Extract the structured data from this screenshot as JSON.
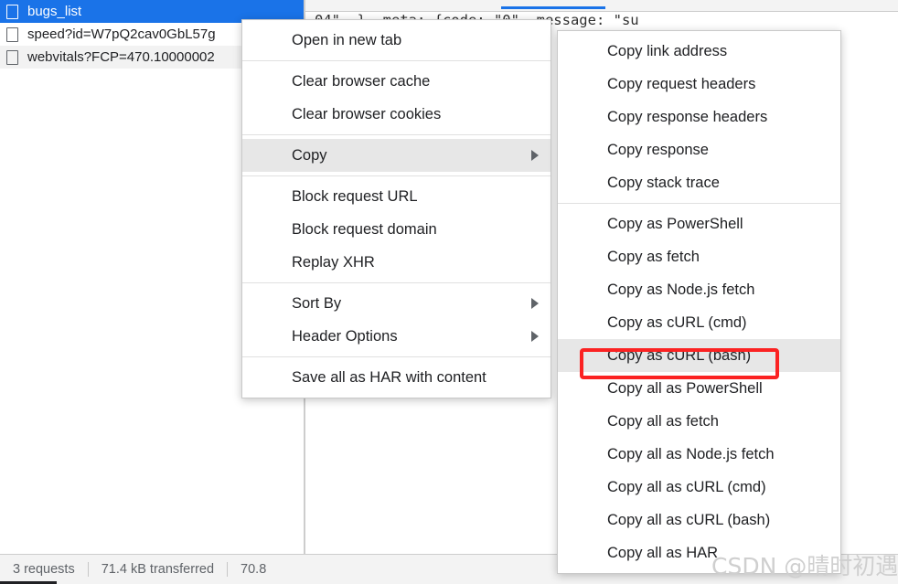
{
  "request_list": {
    "rows": [
      {
        "label": "bugs_list",
        "icon": "document-icon",
        "selected": true
      },
      {
        "label": "speed?id=W7pQ2cav0GbL57g",
        "icon": "document-icon",
        "selected": false
      },
      {
        "label": "webvitals?FCP=470.10000002",
        "icon": "document-icon",
        "selected": false
      }
    ]
  },
  "detail_pane": {
    "response_preview": "04\",…}, meta: {code: \"0\", message: \"su"
  },
  "status_bar": {
    "requests": "3 requests",
    "transferred": "71.4 kB transferred",
    "resources": "70.8"
  },
  "context_menu": {
    "groups": [
      {
        "items": [
          {
            "label": "Open in new tab",
            "has_submenu": false,
            "highlighted": false
          }
        ]
      },
      {
        "items": [
          {
            "label": "Clear browser cache",
            "has_submenu": false,
            "highlighted": false
          },
          {
            "label": "Clear browser cookies",
            "has_submenu": false,
            "highlighted": false
          }
        ]
      },
      {
        "items": [
          {
            "label": "Copy",
            "has_submenu": true,
            "highlighted": true
          }
        ]
      },
      {
        "items": [
          {
            "label": "Block request URL",
            "has_submenu": false,
            "highlighted": false
          },
          {
            "label": "Block request domain",
            "has_submenu": false,
            "highlighted": false
          },
          {
            "label": "Replay XHR",
            "has_submenu": false,
            "highlighted": false
          }
        ]
      },
      {
        "items": [
          {
            "label": "Sort By",
            "has_submenu": true,
            "highlighted": false
          },
          {
            "label": "Header Options",
            "has_submenu": true,
            "highlighted": false
          }
        ]
      },
      {
        "items": [
          {
            "label": "Save all as HAR with content",
            "has_submenu": false,
            "highlighted": false
          }
        ]
      }
    ]
  },
  "copy_submenu": {
    "groups": [
      {
        "items": [
          {
            "label": "Copy link address",
            "highlighted": false
          },
          {
            "label": "Copy request headers",
            "highlighted": false
          },
          {
            "label": "Copy response headers",
            "highlighted": false
          },
          {
            "label": "Copy response",
            "highlighted": false
          },
          {
            "label": "Copy stack trace",
            "highlighted": false
          }
        ]
      },
      {
        "items": [
          {
            "label": "Copy as PowerShell",
            "highlighted": false
          },
          {
            "label": "Copy as fetch",
            "highlighted": false
          },
          {
            "label": "Copy as Node.js fetch",
            "highlighted": false
          },
          {
            "label": "Copy as cURL (cmd)",
            "highlighted": false
          },
          {
            "label": "Copy as cURL (bash)",
            "highlighted": true
          },
          {
            "label": "Copy all as PowerShell",
            "highlighted": false
          },
          {
            "label": "Copy all as fetch",
            "highlighted": false
          },
          {
            "label": "Copy all as Node.js fetch",
            "highlighted": false
          },
          {
            "label": "Copy all as cURL (cmd)",
            "highlighted": false
          },
          {
            "label": "Copy all as cURL (bash)",
            "highlighted": false
          },
          {
            "label": "Copy all as HAR",
            "highlighted": false
          }
        ]
      }
    ]
  },
  "annotation": {
    "target_label": "Copy as cURL (bash)",
    "color": "#fb2222"
  },
  "watermark": {
    "text": "CSDN @晴时初遇雨"
  },
  "colors": {
    "selection_blue": "#1a73e8",
    "menu_highlight": "#e7e7e7",
    "annotation_red": "#fb2222",
    "status_text": "#5f6368"
  }
}
